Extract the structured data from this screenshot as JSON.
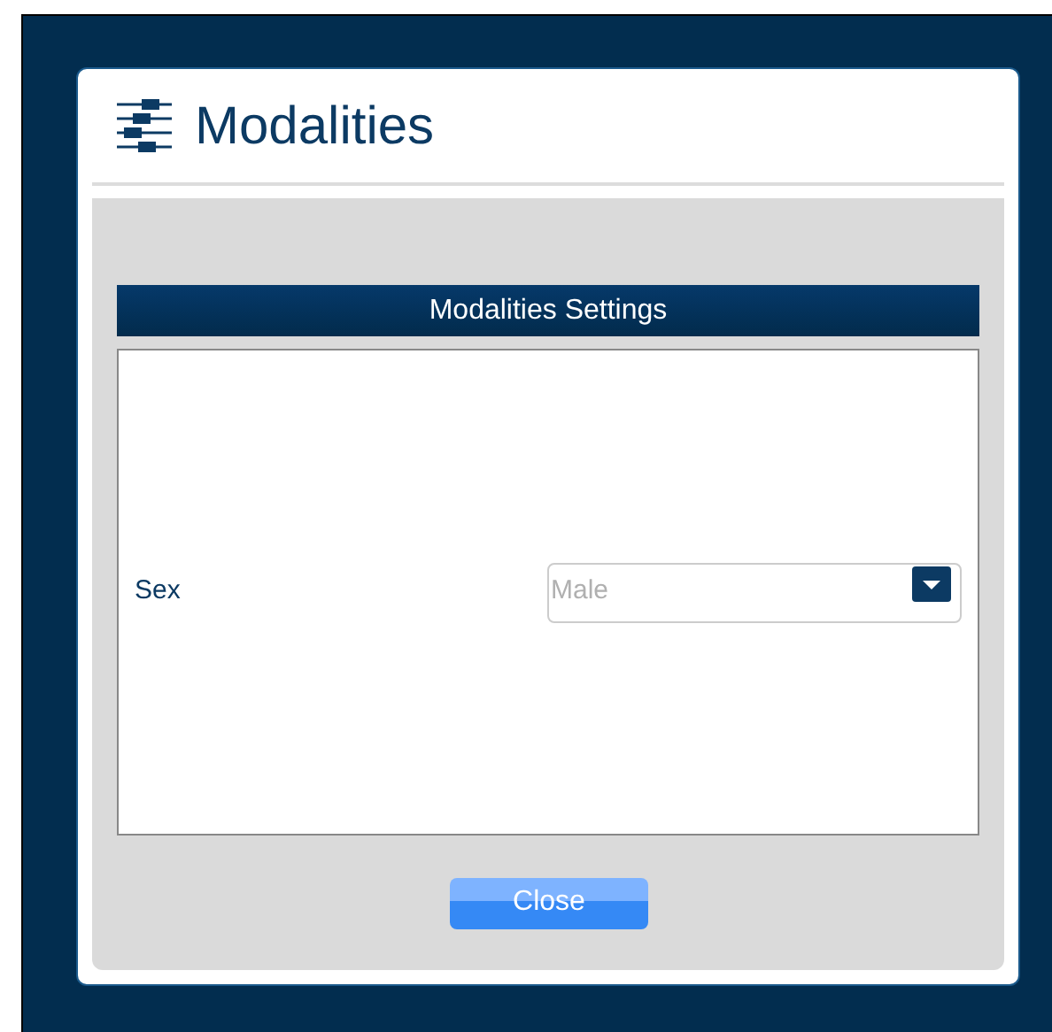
{
  "dialog": {
    "title": "Modalities"
  },
  "section": {
    "title": "Modalities Settings"
  },
  "fields": [
    {
      "label": "Sex",
      "value": "Male",
      "kind": "select"
    }
  ],
  "buttons": [
    "Close"
  ]
}
